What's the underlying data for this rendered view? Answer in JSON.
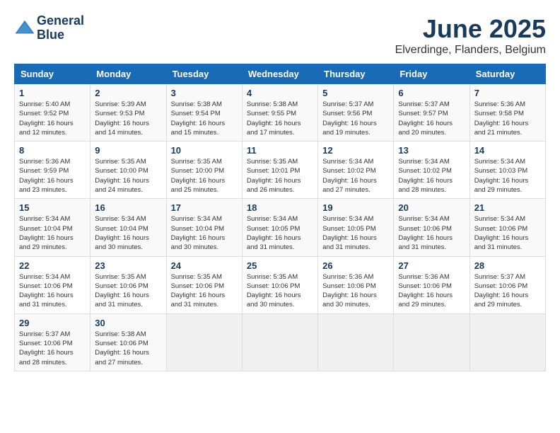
{
  "header": {
    "logo_line1": "General",
    "logo_line2": "Blue",
    "month_year": "June 2025",
    "location": "Elverdinge, Flanders, Belgium"
  },
  "weekdays": [
    "Sunday",
    "Monday",
    "Tuesday",
    "Wednesday",
    "Thursday",
    "Friday",
    "Saturday"
  ],
  "weeks": [
    [
      {
        "day": "1",
        "sunrise": "5:40 AM",
        "sunset": "9:52 PM",
        "daylight": "16 hours and 12 minutes."
      },
      {
        "day": "2",
        "sunrise": "5:39 AM",
        "sunset": "9:53 PM",
        "daylight": "16 hours and 14 minutes."
      },
      {
        "day": "3",
        "sunrise": "5:38 AM",
        "sunset": "9:54 PM",
        "daylight": "16 hours and 15 minutes."
      },
      {
        "day": "4",
        "sunrise": "5:38 AM",
        "sunset": "9:55 PM",
        "daylight": "16 hours and 17 minutes."
      },
      {
        "day": "5",
        "sunrise": "5:37 AM",
        "sunset": "9:56 PM",
        "daylight": "16 hours and 19 minutes."
      },
      {
        "day": "6",
        "sunrise": "5:37 AM",
        "sunset": "9:57 PM",
        "daylight": "16 hours and 20 minutes."
      },
      {
        "day": "7",
        "sunrise": "5:36 AM",
        "sunset": "9:58 PM",
        "daylight": "16 hours and 21 minutes."
      }
    ],
    [
      {
        "day": "8",
        "sunrise": "5:36 AM",
        "sunset": "9:59 PM",
        "daylight": "16 hours and 23 minutes."
      },
      {
        "day": "9",
        "sunrise": "5:35 AM",
        "sunset": "10:00 PM",
        "daylight": "16 hours and 24 minutes."
      },
      {
        "day": "10",
        "sunrise": "5:35 AM",
        "sunset": "10:00 PM",
        "daylight": "16 hours and 25 minutes."
      },
      {
        "day": "11",
        "sunrise": "5:35 AM",
        "sunset": "10:01 PM",
        "daylight": "16 hours and 26 minutes."
      },
      {
        "day": "12",
        "sunrise": "5:34 AM",
        "sunset": "10:02 PM",
        "daylight": "16 hours and 27 minutes."
      },
      {
        "day": "13",
        "sunrise": "5:34 AM",
        "sunset": "10:02 PM",
        "daylight": "16 hours and 28 minutes."
      },
      {
        "day": "14",
        "sunrise": "5:34 AM",
        "sunset": "10:03 PM",
        "daylight": "16 hours and 29 minutes."
      }
    ],
    [
      {
        "day": "15",
        "sunrise": "5:34 AM",
        "sunset": "10:04 PM",
        "daylight": "16 hours and 29 minutes."
      },
      {
        "day": "16",
        "sunrise": "5:34 AM",
        "sunset": "10:04 PM",
        "daylight": "16 hours and 30 minutes."
      },
      {
        "day": "17",
        "sunrise": "5:34 AM",
        "sunset": "10:04 PM",
        "daylight": "16 hours and 30 minutes."
      },
      {
        "day": "18",
        "sunrise": "5:34 AM",
        "sunset": "10:05 PM",
        "daylight": "16 hours and 31 minutes."
      },
      {
        "day": "19",
        "sunrise": "5:34 AM",
        "sunset": "10:05 PM",
        "daylight": "16 hours and 31 minutes."
      },
      {
        "day": "20",
        "sunrise": "5:34 AM",
        "sunset": "10:06 PM",
        "daylight": "16 hours and 31 minutes."
      },
      {
        "day": "21",
        "sunrise": "5:34 AM",
        "sunset": "10:06 PM",
        "daylight": "16 hours and 31 minutes."
      }
    ],
    [
      {
        "day": "22",
        "sunrise": "5:34 AM",
        "sunset": "10:06 PM",
        "daylight": "16 hours and 31 minutes."
      },
      {
        "day": "23",
        "sunrise": "5:35 AM",
        "sunset": "10:06 PM",
        "daylight": "16 hours and 31 minutes."
      },
      {
        "day": "24",
        "sunrise": "5:35 AM",
        "sunset": "10:06 PM",
        "daylight": "16 hours and 31 minutes."
      },
      {
        "day": "25",
        "sunrise": "5:35 AM",
        "sunset": "10:06 PM",
        "daylight": "16 hours and 30 minutes."
      },
      {
        "day": "26",
        "sunrise": "5:36 AM",
        "sunset": "10:06 PM",
        "daylight": "16 hours and 30 minutes."
      },
      {
        "day": "27",
        "sunrise": "5:36 AM",
        "sunset": "10:06 PM",
        "daylight": "16 hours and 29 minutes."
      },
      {
        "day": "28",
        "sunrise": "5:37 AM",
        "sunset": "10:06 PM",
        "daylight": "16 hours and 29 minutes."
      }
    ],
    [
      {
        "day": "29",
        "sunrise": "5:37 AM",
        "sunset": "10:06 PM",
        "daylight": "16 hours and 28 minutes."
      },
      {
        "day": "30",
        "sunrise": "5:38 AM",
        "sunset": "10:06 PM",
        "daylight": "16 hours and 27 minutes."
      },
      null,
      null,
      null,
      null,
      null
    ]
  ],
  "labels": {
    "sunrise": "Sunrise:",
    "sunset": "Sunset:",
    "daylight": "Daylight:"
  }
}
